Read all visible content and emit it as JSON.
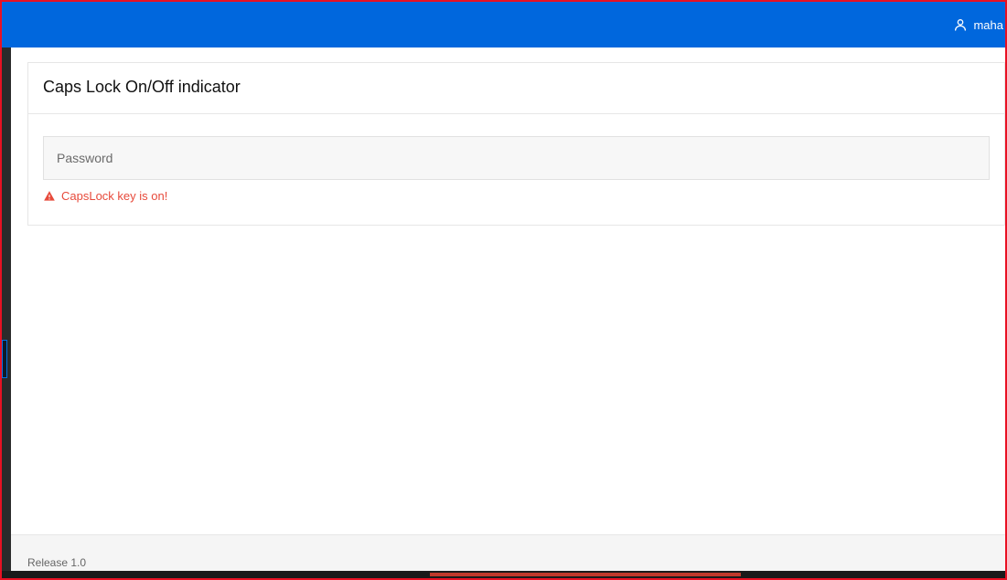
{
  "header": {
    "username": "maha"
  },
  "card": {
    "title": "Caps Lock On/Off indicator",
    "password_placeholder": "Password",
    "warning_text": "CapsLock key is on!"
  },
  "footer": {
    "release": "Release 1.0"
  }
}
